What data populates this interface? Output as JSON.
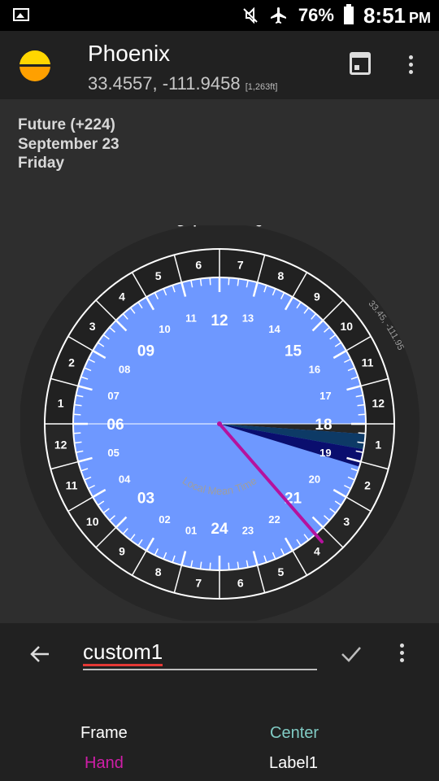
{
  "status_bar": {
    "battery": "76%",
    "time": "8:51",
    "ampm": "PM",
    "icons": [
      "gallery-icon",
      "mute-icon",
      "airplane-icon",
      "battery-icon"
    ]
  },
  "header": {
    "title": "Phoenix",
    "coords": "33.4557, -111.9458",
    "elevation": "[1,263ft]"
  },
  "info": {
    "future": "Future (+224)",
    "date": "September 23",
    "weekday": "Friday"
  },
  "dial": {
    "date_label": "September 23",
    "coords_label": "33.45, -111.95",
    "center_label": "Local Mean Time",
    "outer_top": [
      "5",
      "6",
      "7",
      "8",
      "9",
      "10",
      "11",
      "12",
      "1",
      "2",
      "3",
      "4"
    ],
    "hour_major": [
      "06",
      "09",
      "12",
      "15",
      "18",
      "21",
      "24",
      "03"
    ],
    "colors": {
      "day_am": "#ffd600",
      "day_pm": "#ff9800",
      "night": "#212121",
      "civil": "#6e98ff",
      "nautical": "#0d3a66",
      "astro": "#0a0e6e",
      "hand": "#b5129e"
    }
  },
  "editor": {
    "name": "custom1"
  },
  "legend": {
    "frame": "Frame",
    "center": "Center",
    "hand": "Hand",
    "label1": "Label1",
    "frame_color": "#ffffff",
    "center_color": "#80cbc4",
    "hand_color": "#d01ea8",
    "label1_color": "#ffffff"
  }
}
